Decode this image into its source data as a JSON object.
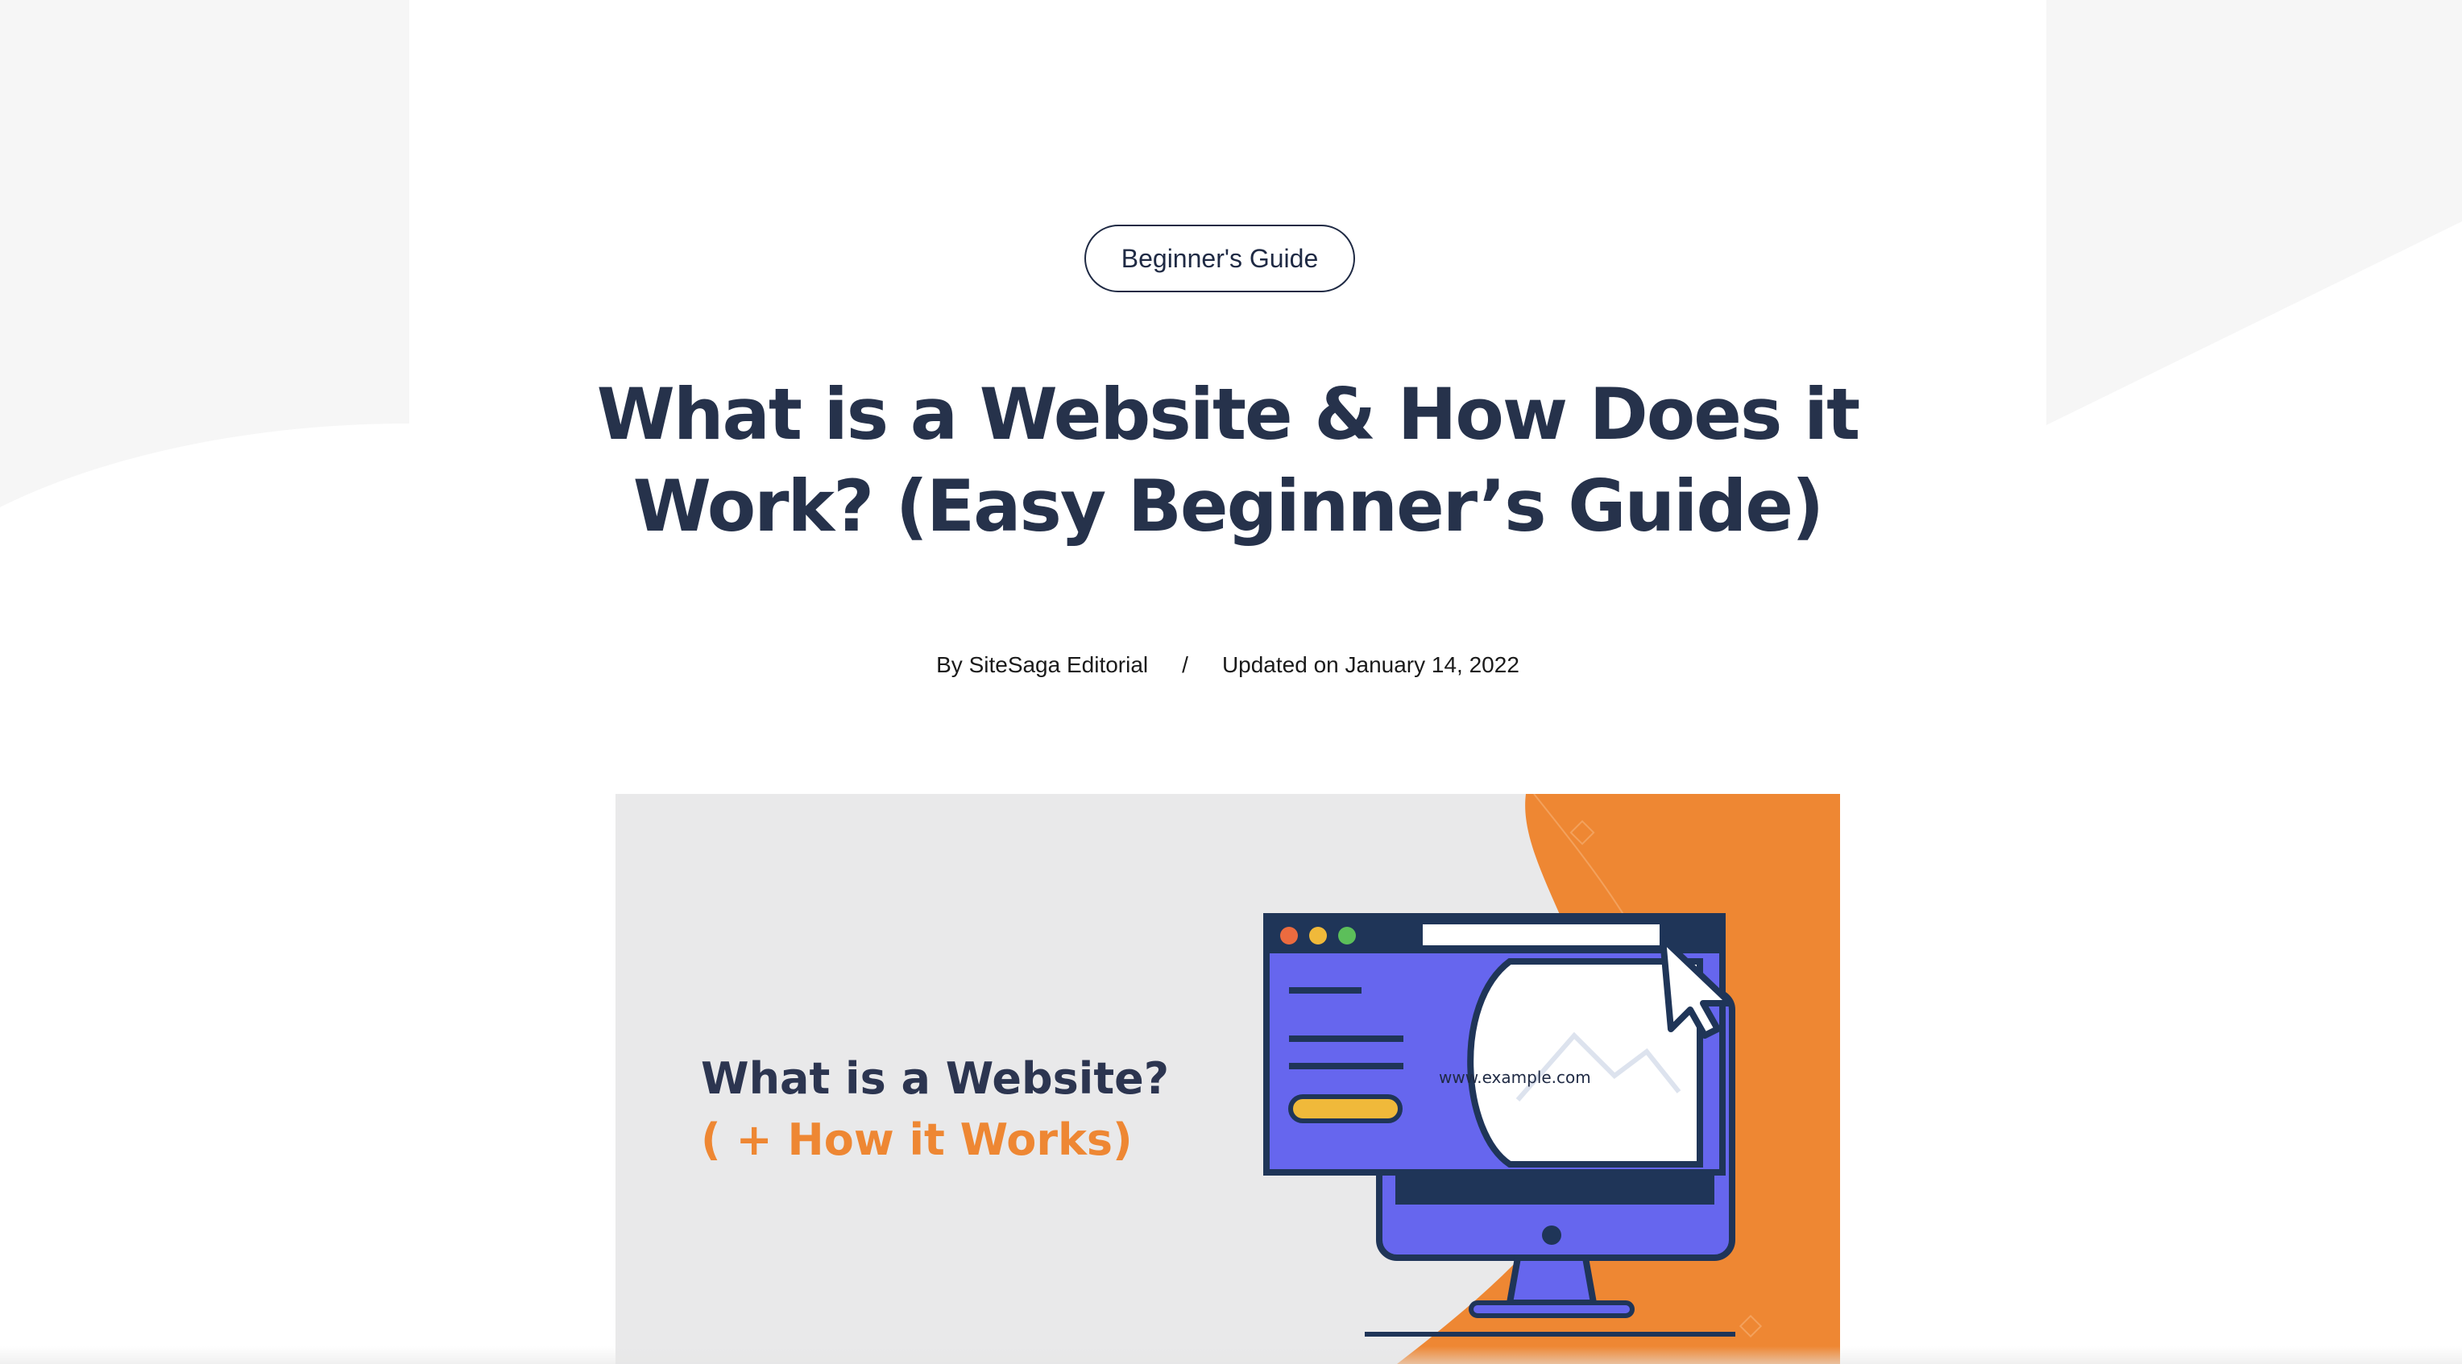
{
  "article": {
    "category": "Beginner's Guide",
    "title": "What is a Website & How Does it Work? (Easy Beginner’s Guide)",
    "author": "By SiteSaga Editorial",
    "separator": "/",
    "updated": "Updated on January 14, 2022"
  },
  "featured_image": {
    "heading": "What is a Website?",
    "subheading": "( + How it Works)",
    "browser_url": "www.example.com",
    "icons": [
      "monitor-icon",
      "cursor-icon",
      "image-placeholder-icon"
    ]
  },
  "colors": {
    "title": "#26324b",
    "accent_orange": "#ee8733",
    "monitor_purple": "#6666ee",
    "monitor_navy": "#1f3558",
    "image_bg": "#e9e9ea"
  }
}
